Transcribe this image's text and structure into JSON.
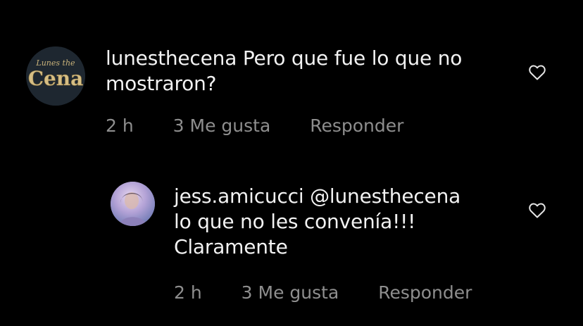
{
  "colors": {
    "background": "#000000",
    "text": "#f2f2f2",
    "meta": "#8e8e8e"
  },
  "comments": [
    {
      "username": "lunesthecena",
      "text_line1_rest": "Pero que fue lo que no",
      "text_line2": "mostraron?",
      "time": "2 h",
      "likes": "3 Me gusta",
      "reply_label": "Responder",
      "avatar_icon": "lunes-the-cena-logo-avatar",
      "avatar_logo_top": "Lunes the",
      "avatar_logo_main": "Cena",
      "like_icon": "heart-outline-icon"
    },
    {
      "username": "jess.amicucci",
      "mention": "@lunesthecena",
      "text_line2": "lo que no les convenía!!!",
      "text_line3": "Claramente",
      "time": "2 h",
      "likes": "3 Me gusta",
      "reply_label": "Responder",
      "avatar_icon": "user-photo-avatar",
      "like_icon": "heart-outline-icon"
    }
  ]
}
